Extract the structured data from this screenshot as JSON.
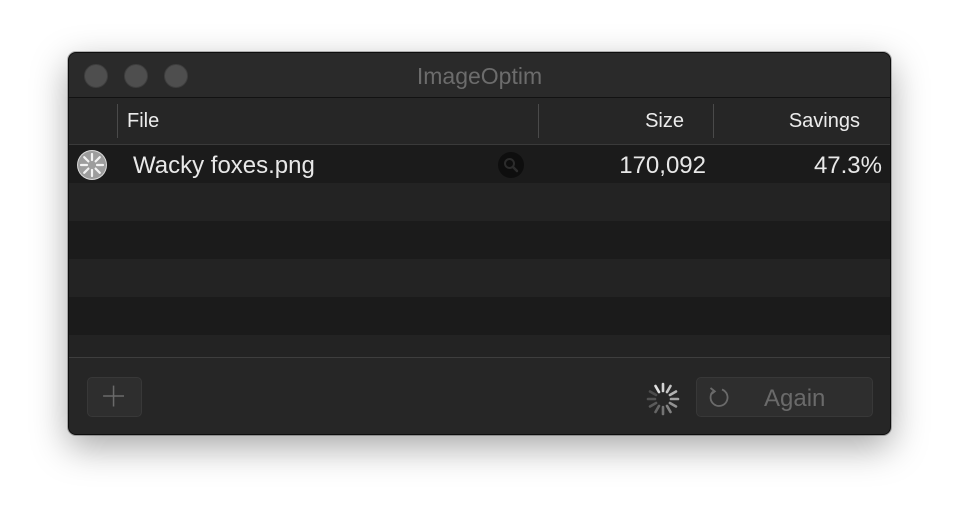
{
  "window": {
    "title": "ImageOptim"
  },
  "columns": {
    "file": "File",
    "size": "Size",
    "savings": "Savings"
  },
  "files": [
    {
      "name": "Wacky foxes.png",
      "size": "170,092",
      "savings": "47.3%",
      "status_icon": "progress-pie-icon",
      "action_icon": "magnifier-reveal-icon"
    }
  ],
  "toolbar": {
    "add_icon": "plus-icon",
    "spinner_icon": "activity-spinner-icon",
    "again_icon": "refresh-icon",
    "again_label": "Again"
  },
  "colors": {
    "window_bg": "#232323",
    "row_alt_bg": "#1b1b1b",
    "text": "#e8e8e8",
    "disabled_text": "#6a6a6a"
  }
}
